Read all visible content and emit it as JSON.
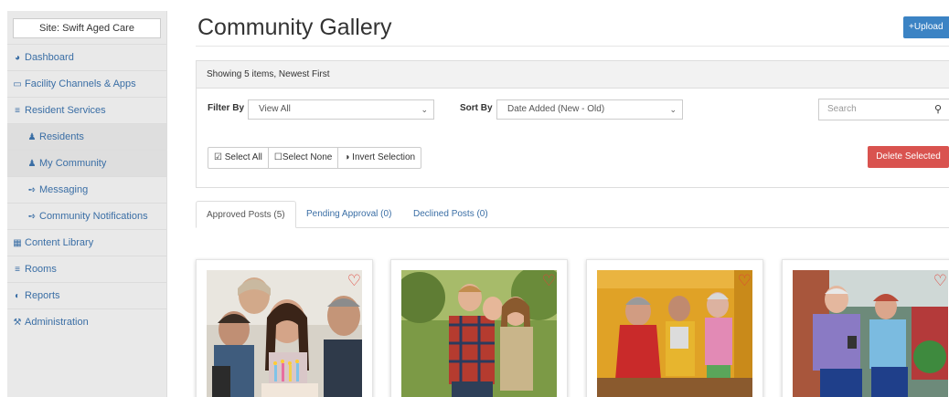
{
  "site": {
    "label": "Site: Swift Aged Care"
  },
  "sidebar": {
    "items": [
      {
        "label": "Dashboard",
        "icon": "dashboard-icon",
        "level": 0
      },
      {
        "label": "Facility Channels & Apps",
        "icon": "monitor-icon",
        "level": 0
      },
      {
        "label": "Resident Services",
        "icon": "signpost-icon",
        "level": 0
      },
      {
        "label": "Residents",
        "icon": "users-icon",
        "level": 1
      },
      {
        "label": "My Community",
        "icon": "users-icon",
        "level": 1
      },
      {
        "label": "Messaging",
        "icon": "megaphone-icon",
        "level": 1
      },
      {
        "label": "Community Notifications",
        "icon": "megaphone-icon",
        "level": 1
      },
      {
        "label": "Content Library",
        "icon": "film-icon",
        "level": 0
      },
      {
        "label": "Rooms",
        "icon": "signpost-icon",
        "level": 0
      },
      {
        "label": "Reports",
        "icon": "chart-icon",
        "level": 0
      },
      {
        "label": "Administration",
        "icon": "wrench-icon",
        "level": 0
      }
    ]
  },
  "header": {
    "title": "Community Gallery",
    "upload_label": "Upload"
  },
  "panel": {
    "summary": "Showing 5 items, Newest First",
    "filter_label": "Filter By",
    "filter_value": "View All",
    "sort_label": "Sort By",
    "sort_value": "Date Added (New - Old)",
    "search_placeholder": "Search",
    "select_all": "Select All",
    "select_none": "Select None",
    "invert_selection": "Invert Selection",
    "delete_selected": "Delete Selected"
  },
  "tabs": [
    {
      "label": "Approved Posts (5)",
      "active": true
    },
    {
      "label": "Pending Approval (0)",
      "active": false
    },
    {
      "label": "Declined Posts (0)",
      "active": false
    }
  ],
  "gallery": {
    "items": [
      {
        "favorite": true
      },
      {
        "favorite": true
      },
      {
        "favorite": true
      },
      {
        "favorite": true
      }
    ]
  },
  "colors": {
    "link": "#3a6ea5",
    "primary": "#3b83c4",
    "danger": "#d9534f",
    "heart": "#e0443a"
  }
}
